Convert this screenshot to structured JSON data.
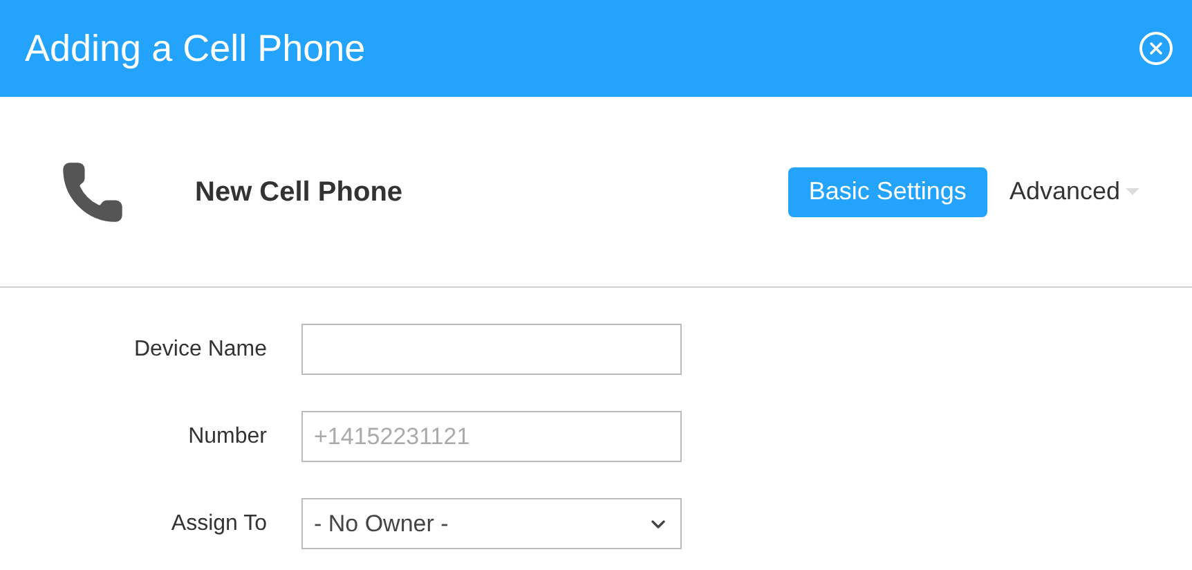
{
  "dialog": {
    "title": "Adding a Cell Phone"
  },
  "device": {
    "name": "New Cell Phone"
  },
  "tabs": [
    {
      "label": "Basic Settings",
      "selected": true,
      "dropdown": false
    },
    {
      "label": "Advanced",
      "selected": false,
      "dropdown": true
    }
  ],
  "fields": [
    {
      "kind": "text",
      "label": "Device Name"
    },
    {
      "kind": "text",
      "label": "Number",
      "placeholder": "+14152231121"
    },
    {
      "kind": "select",
      "label": "Assign To",
      "value": "- No Owner -"
    }
  ]
}
